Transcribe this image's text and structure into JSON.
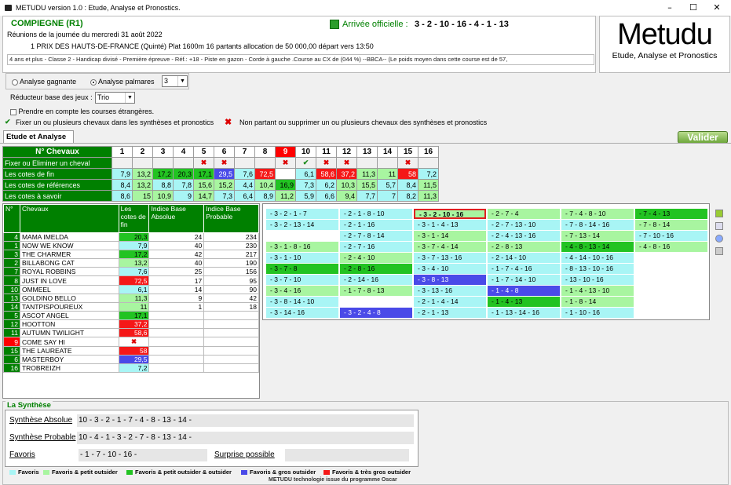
{
  "window": {
    "title": "METUDU version 1.0  : Etude, Analyse et Pronostics.",
    "min": "–",
    "max": "☐",
    "close": "✕"
  },
  "header": {
    "meeting": "COMPIEGNE (R1)",
    "date": "Réunions de la journée du mercredi 31 août 2022",
    "race": "1 PRIX DES HAUTS-DE-FRANCE (Quinté) Plat 1600m 16 partants allocation de 50 000,00 départ vers 13:50",
    "conditions": "4 ans et plus - Classe 2 - Handicap divisé - Première épreuve - Réf.: +18 - Piste en gazon - Corde à gauche .Course au CX de (044 %)  --BBCA--  (Le poids moyen dans cette course est de 57,",
    "arrivee_label": "Arrivée officielle :",
    "arrivee_value": "3 - 2 - 10 - 16 - 4 - 1 - 13"
  },
  "logo": {
    "name": "Metudu",
    "tagline": "Etude, Analyse et Pronostics"
  },
  "options": {
    "analyse_gagnante": "Analyse gagnante",
    "analyse_palmares": "Analyse palmares",
    "palmares_count": "3",
    "reducteur_label": "Réducteur base des jeux :",
    "reducteur_value": "Trio",
    "etrangeres": "Prendre en compte les courses étrangères.",
    "fixer_text": "Fixer un ou plusieurs chevaux dans les synthèses et pronostics",
    "nonpartant_text": "Non partant ou supprimer un ou plusieurs chevaux des synthèses et pronostics"
  },
  "tabs": {
    "etude": "Etude et Analyse",
    "valider": "Valider"
  },
  "grid": {
    "h_chevaux": "N° Chevaux",
    "h_fixer": "Fixer ou Eliminer un cheval",
    "h_fin": "Les cotes de fin",
    "h_ref": "Les cotes de références",
    "h_savoir": "Les cotes à savoir",
    "numbers": [
      "1",
      "2",
      "3",
      "4",
      "5",
      "6",
      "7",
      "8",
      "9",
      "10",
      "11",
      "12",
      "13",
      "14",
      "15",
      "16"
    ],
    "fixer": [
      "",
      "",
      "",
      "",
      "x",
      "x",
      "",
      "",
      "x",
      "c",
      "x",
      "x",
      "",
      "",
      "x",
      ""
    ],
    "fin": [
      {
        "v": "7,9",
        "c": "lb"
      },
      {
        "v": "13,2",
        "c": "lg"
      },
      {
        "v": "17,2",
        "c": "g"
      },
      {
        "v": "20,3",
        "c": "g"
      },
      {
        "v": "17,1",
        "c": "g"
      },
      {
        "v": "29,5",
        "c": "b"
      },
      {
        "v": "7,6",
        "c": "lb"
      },
      {
        "v": "72,5",
        "c": "r"
      },
      {
        "v": "",
        "c": "w"
      },
      {
        "v": "6,1",
        "c": "lb"
      },
      {
        "v": "58,6",
        "c": "r"
      },
      {
        "v": "37,2",
        "c": "r"
      },
      {
        "v": "11,3",
        "c": "lg"
      },
      {
        "v": "11",
        "c": "lg"
      },
      {
        "v": "58",
        "c": "r"
      },
      {
        "v": "7,2",
        "c": "lb"
      }
    ],
    "ref": [
      {
        "v": "8,4",
        "c": "lb"
      },
      {
        "v": "13,2",
        "c": "lg"
      },
      {
        "v": "8,8",
        "c": "lb"
      },
      {
        "v": "7,8",
        "c": "lb"
      },
      {
        "v": "15,6",
        "c": "lg"
      },
      {
        "v": "15,2",
        "c": "lg"
      },
      {
        "v": "4,4",
        "c": "lb"
      },
      {
        "v": "10,4",
        "c": "lg"
      },
      {
        "v": "16,9",
        "c": "g"
      },
      {
        "v": "7,3",
        "c": "lb"
      },
      {
        "v": "6,2",
        "c": "lb"
      },
      {
        "v": "10,3",
        "c": "lg"
      },
      {
        "v": "15,5",
        "c": "lg"
      },
      {
        "v": "5,7",
        "c": "lb"
      },
      {
        "v": "8,4",
        "c": "lb"
      },
      {
        "v": "11,5",
        "c": "lg"
      }
    ],
    "savoir": [
      {
        "v": "8,6",
        "c": "lb"
      },
      {
        "v": "15",
        "c": "lg"
      },
      {
        "v": "10,9",
        "c": "lg"
      },
      {
        "v": "9",
        "c": "lb"
      },
      {
        "v": "14,7",
        "c": "lg"
      },
      {
        "v": "7,3",
        "c": "lb"
      },
      {
        "v": "6,4",
        "c": "lb"
      },
      {
        "v": "8,9",
        "c": "lb"
      },
      {
        "v": "11,2",
        "c": "lg"
      },
      {
        "v": "5,9",
        "c": "lb"
      },
      {
        "v": "6,6",
        "c": "lb"
      },
      {
        "v": "9,4",
        "c": "lg"
      },
      {
        "v": "7,7",
        "c": "lb"
      },
      {
        "v": "7",
        "c": "lb"
      },
      {
        "v": "8,2",
        "c": "lb"
      },
      {
        "v": "11,3",
        "c": "lg"
      }
    ]
  },
  "horses": {
    "h_n": "N°",
    "h_name": "Chevaux",
    "h_cote": "Les cotes de fin",
    "h_ia": "Indice Base Absolue",
    "h_ip": "Indice Base Probable",
    "rows": [
      {
        "n": "4",
        "name": "MAMA IMELDA",
        "cote": "20,3",
        "c": "g",
        "ia": "24",
        "ip": "234",
        "nc": "nb"
      },
      {
        "n": "1",
        "name": "NOW WE KNOW",
        "cote": "7,9",
        "c": "lb",
        "ia": "40",
        "ip": "230",
        "nc": "nb"
      },
      {
        "n": "3",
        "name": "THE CHARMER",
        "cote": "17,2",
        "c": "g",
        "ia": "42",
        "ip": "217",
        "nc": "nb"
      },
      {
        "n": "2",
        "name": "BILLABONG CAT",
        "cote": "13,2",
        "c": "lg",
        "ia": "40",
        "ip": "190",
        "nc": "nb"
      },
      {
        "n": "7",
        "name": "ROYAL ROBBINS",
        "cote": "7,6",
        "c": "lb",
        "ia": "25",
        "ip": "156",
        "nc": "nb"
      },
      {
        "n": "8",
        "name": "JUST IN LOVE",
        "cote": "72,5",
        "c": "r",
        "ia": "17",
        "ip": "95",
        "nc": "nb"
      },
      {
        "n": "10",
        "name": "OMMEEL",
        "cote": "6,1",
        "c": "lb",
        "ia": "14",
        "ip": "90",
        "nc": "nb"
      },
      {
        "n": "13",
        "name": "GOLDINO BELLO",
        "cote": "11,3",
        "c": "lg",
        "ia": "9",
        "ip": "42",
        "nc": "nb"
      },
      {
        "n": "14",
        "name": "TANTPISPOUREUX",
        "cote": "11",
        "c": "lg",
        "ia": "1",
        "ip": "18",
        "nc": "nb"
      },
      {
        "n": "5",
        "name": "ASCOT ANGEL",
        "cote": "17,1",
        "c": "g",
        "ia": "",
        "ip": "",
        "nc": "nb"
      },
      {
        "n": "12",
        "name": "HOOTTON",
        "cote": "37,2",
        "c": "r",
        "ia": "",
        "ip": "",
        "nc": "nb"
      },
      {
        "n": "11",
        "name": "AUTUMN TWILIGHT",
        "cote": "58,6",
        "c": "r",
        "ia": "",
        "ip": "",
        "nc": "nb"
      },
      {
        "n": "9",
        "name": "COME SAY HI",
        "cote": "",
        "c": "x",
        "ia": "",
        "ip": "",
        "nc": "nbr"
      },
      {
        "n": "15",
        "name": "THE LAUREATE",
        "cote": "58",
        "c": "r",
        "ia": "",
        "ip": "",
        "nc": "nb"
      },
      {
        "n": "6",
        "name": "MASTERBOY",
        "cote": "29,5",
        "c": "b",
        "ia": "",
        "ip": "",
        "nc": "nb"
      },
      {
        "n": "16",
        "name": "TROBREIZH",
        "cote": "7,2",
        "c": "lb",
        "ia": "",
        "ip": "",
        "nc": "nb"
      }
    ]
  },
  "combos": [
    [
      {
        "t": "- 3 - 2 - 1 - 7",
        "c": "lb"
      },
      {
        "t": "- 3 - 2 - 13 - 14",
        "c": "lb"
      },
      {
        "t": "",
        "c": "w"
      },
      {
        "t": "- 3 - 1 - 8 - 16",
        "c": "lg"
      },
      {
        "t": "- 3 - 1 - 10",
        "c": "lb"
      },
      {
        "t": "- 3 - 7 - 8",
        "c": "g"
      },
      {
        "t": "- 3 - 7 - 10",
        "c": "lb"
      },
      {
        "t": "- 3 - 4 - 16",
        "c": "lg"
      },
      {
        "t": "- 3 - 8 - 14 - 10",
        "c": "lb"
      },
      {
        "t": "- 3 - 14 - 16",
        "c": "lb"
      }
    ],
    [
      {
        "t": "- 2 - 1 - 8 - 10",
        "c": "lb"
      },
      {
        "t": "- 2 - 1 - 16",
        "c": "lb"
      },
      {
        "t": "- 2 - 7 - 8 - 14",
        "c": "lb"
      },
      {
        "t": "- 2 - 7 - 16",
        "c": "lb"
      },
      {
        "t": "- 2 - 4 - 10",
        "c": "lg"
      },
      {
        "t": "- 2 - 8 - 16",
        "c": "g"
      },
      {
        "t": "- 2 - 14 - 16",
        "c": "lb"
      },
      {
        "t": "- 1 - 7 - 8 - 13",
        "c": "lg"
      },
      {
        "t": "",
        "c": "w"
      },
      {
        "t": "- 3 - 2 - 4 - 8",
        "c": "b"
      }
    ],
    [
      {
        "t": "- 3 - 2 - 10 - 16",
        "c": "lg",
        "sel": true
      },
      {
        "t": "- 3 - 1 - 4 - 13",
        "c": "lb"
      },
      {
        "t": "- 3 - 1 - 14",
        "c": "lg"
      },
      {
        "t": "- 3 - 7 - 4 - 14",
        "c": "lg"
      },
      {
        "t": "- 3 - 7 - 13 - 16",
        "c": "lb"
      },
      {
        "t": "- 3 - 4 - 10",
        "c": "lb"
      },
      {
        "t": "- 3 - 8 - 13",
        "c": "b"
      },
      {
        "t": "- 3 - 13 - 16",
        "c": "lb"
      },
      {
        "t": "- 2 - 1 - 4 - 14",
        "c": "lb"
      },
      {
        "t": "- 2 - 1 - 13",
        "c": "lb"
      }
    ],
    [
      {
        "t": "- 2 - 7 - 4",
        "c": "lg"
      },
      {
        "t": "- 2 - 7 - 13 - 10",
        "c": "lb"
      },
      {
        "t": "- 2 - 4 - 13 - 16",
        "c": "lb"
      },
      {
        "t": "- 2 - 8 - 13",
        "c": "lg"
      },
      {
        "t": "- 2 - 14 - 10",
        "c": "lb"
      },
      {
        "t": "- 1 - 7 - 4 - 16",
        "c": "lb"
      },
      {
        "t": "- 1 - 7 - 14 - 10",
        "c": "lb"
      },
      {
        "t": "- 1 - 4 - 8",
        "c": "b"
      },
      {
        "t": "- 1 - 4 - 13",
        "c": "g"
      },
      {
        "t": "- 1 - 13 - 14 - 16",
        "c": "lb"
      }
    ],
    [
      {
        "t": "- 7 - 4 - 8 - 10",
        "c": "lg"
      },
      {
        "t": "- 7 - 8 - 14 - 16",
        "c": "lb"
      },
      {
        "t": "- 7 - 13 - 14",
        "c": "lg"
      },
      {
        "t": "- 4 - 8 - 13 - 14",
        "c": "g"
      },
      {
        "t": "- 4 - 14 - 10 - 16",
        "c": "lb"
      },
      {
        "t": "- 8 - 13 - 10 - 16",
        "c": "lb"
      },
      {
        "t": "- 13 - 10 - 16",
        "c": "lb"
      },
      {
        "t": "- 1 - 4 - 13 - 10",
        "c": "lg"
      },
      {
        "t": "- 1 - 8 - 14",
        "c": "lg"
      },
      {
        "t": "- 1 - 10 - 16",
        "c": "lb"
      }
    ],
    [
      {
        "t": "- 7 - 4 - 13",
        "c": "g"
      },
      {
        "t": "- 7 - 8 - 14",
        "c": "lg"
      },
      {
        "t": "- 7 - 10 - 16",
        "c": "lb"
      },
      {
        "t": "- 4 - 8 - 16",
        "c": "lg"
      }
    ]
  ],
  "synthese": {
    "legend": "La Synthèse",
    "absolue_label": "Synthèse Absolue",
    "absolue_value": "10 - 3 - 2 - 1 - 7 - 4 - 8 - 13 - 14 -",
    "probable_label": "Synthèse Probable",
    "probable_value": "10 - 4 - 1 - 3 - 2 - 7 - 8 - 13 - 14 -",
    "favoris_label": "Favoris",
    "favoris_value": "- 1 - 7 - 10 - 16 -",
    "surprise_label": "Surprise possible",
    "surprise_value": ""
  },
  "legend": [
    {
      "label": "Favoris",
      "color": "#a8f5f5"
    },
    {
      "label": "Favoris & petit outsider",
      "color": "#a8f5a0"
    },
    {
      "label": "Favoris & petit outsider & outsider",
      "color": "#22c322"
    },
    {
      "label": "Favoris & gros outsider",
      "color": "#4a4ae8"
    },
    {
      "label": "Favoris & très gros outsider",
      "color": "#f51818"
    }
  ],
  "footer": "METUDU technologie issue du programme Oscar"
}
